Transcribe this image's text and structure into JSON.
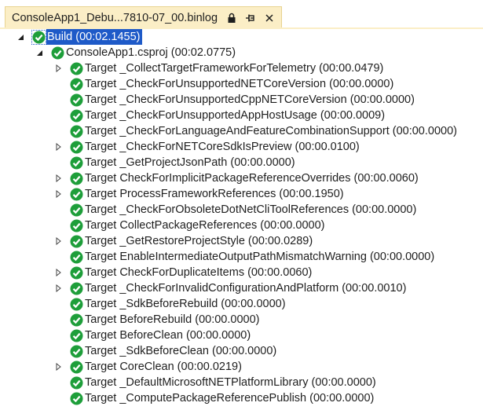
{
  "tab": {
    "title": "ConsoleApp1_Debu...7810-07_00.binlog"
  },
  "tree": {
    "root": {
      "label": "Build (00:02.1455)"
    },
    "project": {
      "label": "ConsoleApp1.csproj (00:02.0775)"
    },
    "targets": [
      {
        "label": "Target _CollectTargetFrameworkForTelemetry (00:00.0479)",
        "expandable": true
      },
      {
        "label": "Target _CheckForUnsupportedNETCoreVersion (00:00.0000)",
        "expandable": false
      },
      {
        "label": "Target _CheckForUnsupportedCppNETCoreVersion (00:00.0000)",
        "expandable": false
      },
      {
        "label": "Target _CheckForUnsupportedAppHostUsage (00:00.0009)",
        "expandable": false
      },
      {
        "label": "Target _CheckForLanguageAndFeatureCombinationSupport (00:00.0000)",
        "expandable": false
      },
      {
        "label": "Target _CheckForNETCoreSdkIsPreview (00:00.0100)",
        "expandable": true
      },
      {
        "label": "Target _GetProjectJsonPath (00:00.0000)",
        "expandable": false
      },
      {
        "label": "Target CheckForImplicitPackageReferenceOverrides (00:00.0060)",
        "expandable": true
      },
      {
        "label": "Target ProcessFrameworkReferences (00:00.1950)",
        "expandable": true
      },
      {
        "label": "Target _CheckForObsoleteDotNetCliToolReferences (00:00.0000)",
        "expandable": false
      },
      {
        "label": "Target CollectPackageReferences (00:00.0000)",
        "expandable": false
      },
      {
        "label": "Target _GetRestoreProjectStyle (00:00.0289)",
        "expandable": true
      },
      {
        "label": "Target EnableIntermediateOutputPathMismatchWarning (00:00.0000)",
        "expandable": false
      },
      {
        "label": "Target CheckForDuplicateItems (00:00.0060)",
        "expandable": true
      },
      {
        "label": "Target _CheckForInvalidConfigurationAndPlatform (00:00.0010)",
        "expandable": true
      },
      {
        "label": "Target _SdkBeforeRebuild (00:00.0000)",
        "expandable": false
      },
      {
        "label": "Target BeforeRebuild (00:00.0000)",
        "expandable": false
      },
      {
        "label": "Target BeforeClean (00:00.0000)",
        "expandable": false
      },
      {
        "label": "Target _SdkBeforeClean (00:00.0000)",
        "expandable": false
      },
      {
        "label": "Target CoreClean (00:00.0219)",
        "expandable": true
      },
      {
        "label": "Target _DefaultMicrosoftNETPlatformLibrary (00:00.0000)",
        "expandable": false
      },
      {
        "label": "Target _ComputePackageReferencePublish (00:00.0000)",
        "expandable": false
      }
    ]
  },
  "colors": {
    "success": "#1e9e3a",
    "selection": "#1e5ac8",
    "tab_active": "#fbeec6"
  },
  "icons": {
    "tab": [
      "lock-icon",
      "pin-icon",
      "close-icon"
    ],
    "status": "success-check-icon",
    "expander": "triangle-icon"
  }
}
